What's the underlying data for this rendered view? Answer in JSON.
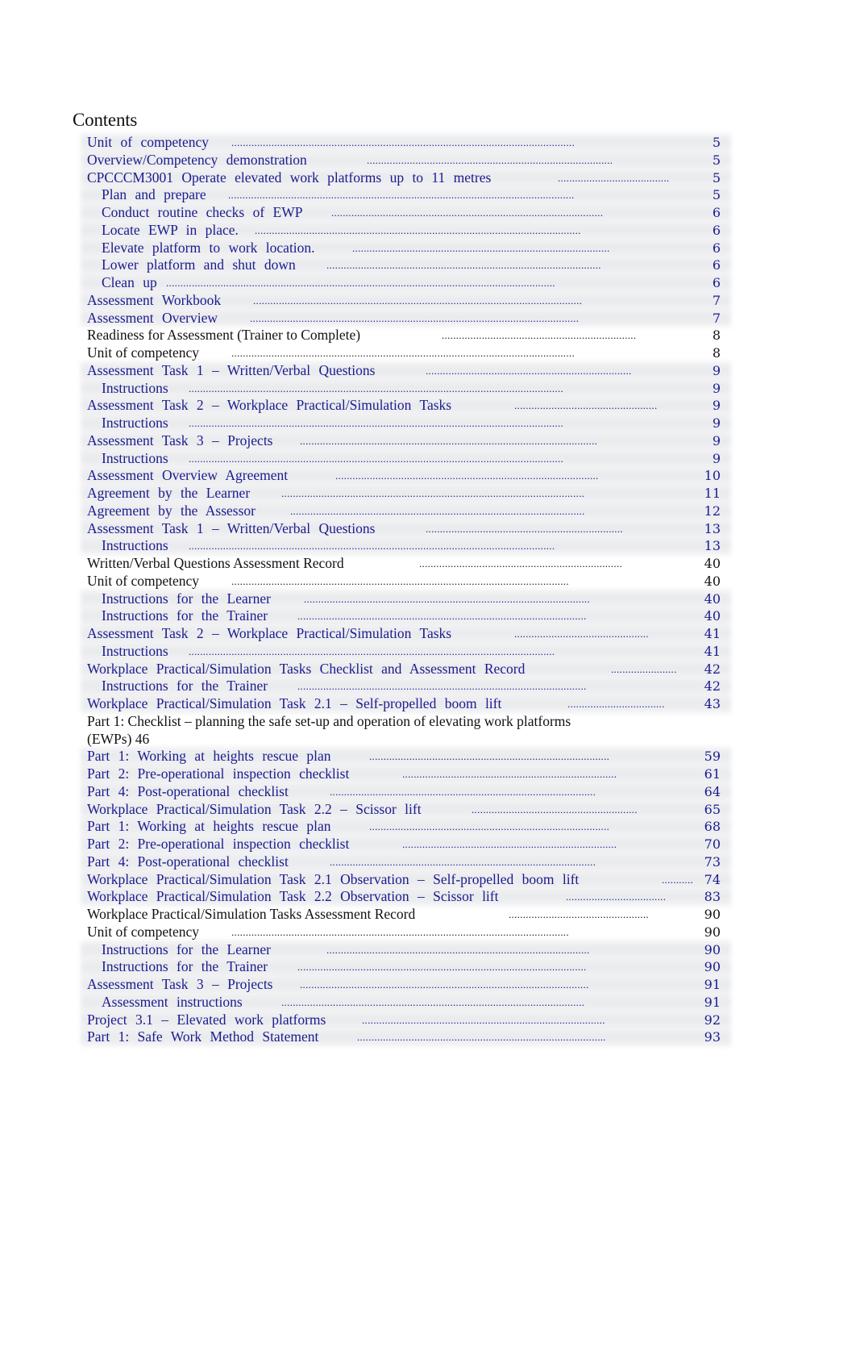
{
  "document": {
    "heading": "Contents",
    "colors": {
      "link": "#1b1b8f",
      "plain": "#111111",
      "band": "#e4e5e8"
    },
    "entries": [
      {
        "label": "Unit  of competency",
        "page": "5",
        "level": 1,
        "style": "link",
        "leader_from": 287,
        "leader_to": 757
      },
      {
        "label": "Overview/Competency demonstration",
        "page": "5",
        "level": 1,
        "style": "link",
        "leader_from": 455,
        "leader_to": 792
      },
      {
        "label": "CPCCCM3001   Operate    elevated    work platforms     up to   11 metres",
        "page": "5",
        "level": 1,
        "style": "link",
        "leader_from": 692,
        "leader_to": 845
      },
      {
        "label": "Plan  and prepare",
        "page": "5",
        "level": 2,
        "style": "link",
        "leader_from": 283,
        "leader_to": 756
      },
      {
        "label": "Conduct    routine    checks    of  EWP",
        "page": "6",
        "level": 2,
        "style": "link",
        "leader_from": 411,
        "leader_to": 784
      },
      {
        "label": "Locate    EWP in place.",
        "page": "6",
        "level": 2,
        "style": "link",
        "leader_from": 316,
        "leader_to": 763
      },
      {
        "label": "Elevate    platform to     work location.",
        "page": "6",
        "level": 2,
        "style": "link",
        "leader_from": 437,
        "leader_to": 790
      },
      {
        "label": "Lower   platform    and shut down",
        "page": "6",
        "level": 2,
        "style": "link",
        "leader_from": 405,
        "leader_to": 782
      },
      {
        "label": "Clean   up",
        "page": "6",
        "level": 2,
        "style": "link",
        "leader_from": 206,
        "leader_to": 740
      },
      {
        "label": "Assessment     Workbook",
        "page": "7",
        "level": 1,
        "style": "link",
        "leader_from": 314,
        "leader_to": 765
      },
      {
        "label": "Assessment     Overview",
        "page": "7",
        "level": 1,
        "style": "link",
        "leader_from": 310,
        "leader_to": 762
      },
      {
        "label": "Readiness for Assessment (Trainer to Complete)",
        "page": "8",
        "level": 1,
        "style": "plain",
        "leader_from": 548,
        "leader_to": 814
      },
      {
        "label": "Unit of competency",
        "page": "8",
        "level": 1,
        "style": "plain",
        "leader_from": 287,
        "leader_to": 757
      },
      {
        "label": "Assessment     Task 1 – Written/Verbal Questions",
        "page": "9",
        "level": 1,
        "style": "link",
        "leader_from": 528,
        "leader_to": 809
      },
      {
        "label": "Instructions",
        "page": "9",
        "level": 2,
        "style": "link",
        "leader_from": 234,
        "leader_to": 746
      },
      {
        "label": "Assessment     Task 2    – Workplace     Practical/Simulation       Tasks",
        "page": "9",
        "level": 1,
        "style": "link",
        "leader_from": 638,
        "leader_to": 833
      },
      {
        "label": "Instructions",
        "page": "9",
        "level": 2,
        "style": "link",
        "leader_from": 234,
        "leader_to": 746
      },
      {
        "label": "Assessment     Task 3 –    Projects",
        "page": "9",
        "level": 1,
        "style": "link",
        "leader_from": 372,
        "leader_to": 778
      },
      {
        "label": "Instructions",
        "page": "9",
        "level": 2,
        "style": "link",
        "leader_from": 234,
        "leader_to": 746
      },
      {
        "label": "Assessment     Overview    Agreement",
        "page": "10",
        "level": 1,
        "style": "link",
        "leader_from": 416,
        "leader_to": 778
      },
      {
        "label": "Agreement by      the   Learner",
        "page": "11",
        "level": 1,
        "style": "link",
        "leader_from": 349,
        "leader_to": 763
      },
      {
        "label": "Agreement by      the   Assessor",
        "page": "12",
        "level": 1,
        "style": "link",
        "leader_from": 360,
        "leader_to": 764
      },
      {
        "label": "Assessment     Task 1 – Written/Verbal Questions",
        "page": "13",
        "level": 1,
        "style": "link",
        "leader_from": 528,
        "leader_to": 800
      },
      {
        "label": "Instructions",
        "page": "13",
        "level": 2,
        "style": "link",
        "leader_from": 234,
        "leader_to": 737
      },
      {
        "label": "Written/Verbal Questions Assessment Record",
        "page": "40",
        "level": 1,
        "style": "plain",
        "leader_from": 520,
        "leader_to": 798
      },
      {
        "label": "Unit of competency",
        "page": "40",
        "level": 1,
        "style": "plain",
        "leader_from": 287,
        "leader_to": 748
      },
      {
        "label": "Instructions for      the   Learner",
        "page": "40",
        "level": 2,
        "style": "link",
        "leader_from": 377,
        "leader_to": 767
      },
      {
        "label": "Instructions for the       Trainer",
        "page": "40",
        "level": 2,
        "style": "link",
        "leader_from": 369,
        "leader_to": 765
      },
      {
        "label": "Assessment     Task 2    – Workplace     Practical/Simulation       Tasks",
        "page": "41",
        "level": 1,
        "style": "link",
        "leader_from": 638,
        "leader_to": 825
      },
      {
        "label": "Instructions",
        "page": "41",
        "level": 2,
        "style": "link",
        "leader_from": 234,
        "leader_to": 737
      },
      {
        "label": "Workplace     Practical/Simulation       Tasks   Checklist    and   Assessment      Record",
        "page": "42",
        "level": 1,
        "style": "link",
        "leader_from": 758,
        "leader_to": 851
      },
      {
        "label": "Instructions for the       Trainer",
        "page": "42",
        "level": 2,
        "style": "link",
        "leader_from": 369,
        "leader_to": 765
      },
      {
        "label": "Workplace     Practical/Simulation       Task   2.1   – Self-propelled      boom lift",
        "page": "43",
        "level": 1,
        "style": "link",
        "leader_from": 704,
        "leader_to": 839
      },
      {
        "label": "Part 1: Checklist – planning the safe set-up and operation of elevating work platforms (EWPs)   46",
        "page": "",
        "level": 1,
        "style": "wrap",
        "leader_from": 0,
        "leader_to": 0
      },
      {
        "label": "Part   1: Working     at  heights rescue       plan",
        "page": "59",
        "level": 1,
        "style": "link",
        "leader_from": 458,
        "leader_to": 787
      },
      {
        "label": "Part   2: Pre-operational inspection checklist",
        "page": "61",
        "level": 1,
        "style": "link",
        "leader_from": 499,
        "leader_to": 794
      },
      {
        "label": "Part   4: Post-operational       checklist",
        "page": "64",
        "level": 1,
        "style": "link",
        "leader_from": 409,
        "leader_to": 773
      },
      {
        "label": "Workplace     Practical/Simulation Task       2.2   – Scissor    lift",
        "page": "65",
        "level": 1,
        "style": "link",
        "leader_from": 585,
        "leader_to": 815
      },
      {
        "label": "Part   1: Working     at  heights rescue       plan",
        "page": "68",
        "level": 1,
        "style": "link",
        "leader_from": 458,
        "leader_to": 787
      },
      {
        "label": "Part   2: Pre-operational inspection checklist",
        "page": "70",
        "level": 1,
        "style": "link",
        "leader_from": 499,
        "leader_to": 794
      },
      {
        "label": "Part   4: Post-operational       checklist",
        "page": "73",
        "level": 1,
        "style": "link",
        "leader_from": 409,
        "leader_to": 773
      },
      {
        "label": "Workplace     Practical/Simulation       Task 2.1    Observation     – Self-propelled     boom    lift",
        "page": "74",
        "level": 1,
        "style": "link",
        "leader_from": 821,
        "leader_to": 864
      },
      {
        "label": "Workplace     Practical/Simulation Task 2.2        Observation –      Scissor    lift",
        "page": "83",
        "level": 1,
        "style": "link",
        "leader_from": 702,
        "leader_to": 839
      },
      {
        "label": "Workplace Practical/Simulation Tasks Assessment Record",
        "page": "90",
        "level": 1,
        "style": "plain",
        "leader_from": 631,
        "leader_to": 824
      },
      {
        "label": "Unit of competency",
        "page": "90",
        "level": 1,
        "style": "plain",
        "leader_from": 287,
        "leader_to": 748
      },
      {
        "label": "Instructions for the       Learner",
        "page": "90",
        "level": 2,
        "style": "link",
        "leader_from": 405,
        "leader_to": 767
      },
      {
        "label": "Instructions for the       Trainer",
        "page": "90",
        "level": 2,
        "style": "link",
        "leader_from": 369,
        "leader_to": 765
      },
      {
        "label": "Assessment     Task 3 –    Projects",
        "page": "91",
        "level": 1,
        "style": "link",
        "leader_from": 372,
        "leader_to": 769
      },
      {
        "label": "Assessment     instructions",
        "page": "91",
        "level": 2,
        "style": "link",
        "leader_from": 349,
        "leader_to": 763
      },
      {
        "label": "Project    3.1   – Elevated     work platforms",
        "page": "92",
        "level": 1,
        "style": "link",
        "leader_from": 449,
        "leader_to": 784
      },
      {
        "label": "Part   1: Safe    Work Method     Statement",
        "page": "93",
        "level": 1,
        "style": "link",
        "leader_from": 443,
        "leader_to": 783
      }
    ]
  }
}
